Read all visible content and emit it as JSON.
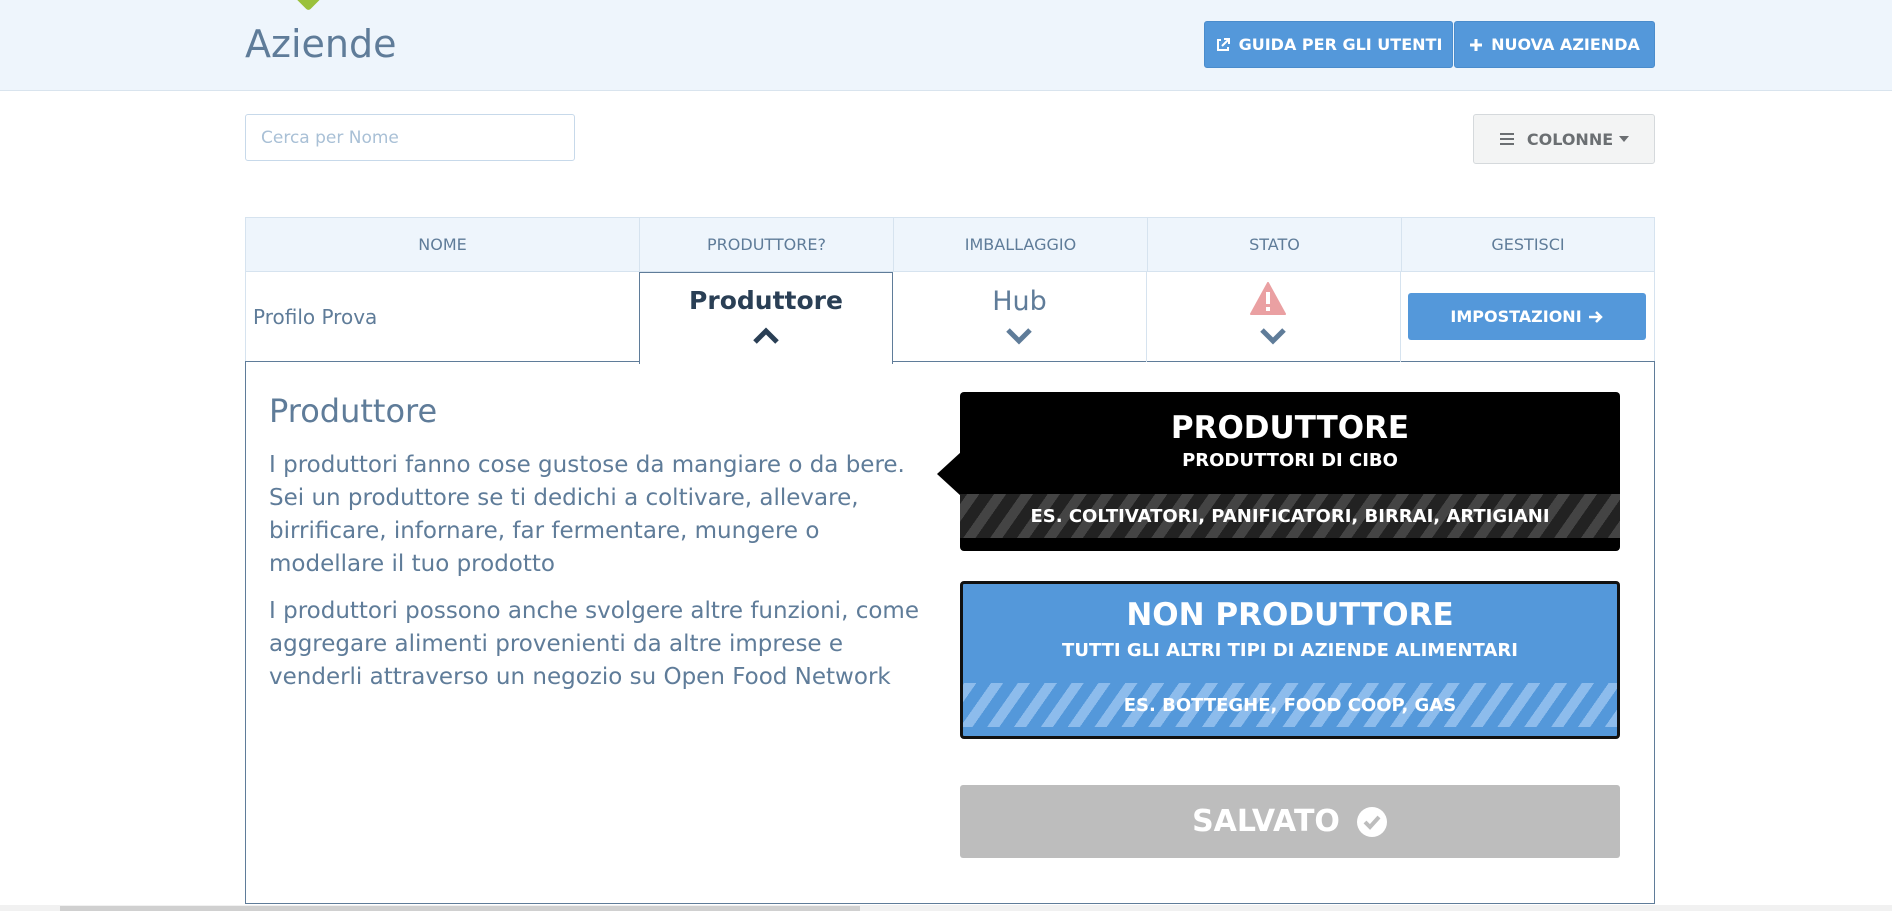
{
  "header": {
    "title": "Aziende",
    "guide_button": "GUIDA PER GLI UTENTI",
    "new_button": "NUOVA AZIENDA",
    "brand_color": "#5498da"
  },
  "toolbar": {
    "search_placeholder": "Cerca per Nome",
    "search_value": "",
    "columns_button": "COLONNE"
  },
  "table": {
    "columns": [
      "NOME",
      "PRODUTTORE?",
      "IMBALLAGGIO",
      "STATO",
      "GESTISCI"
    ],
    "rows": [
      {
        "name": "Profilo Prova",
        "producer": "Produttore",
        "packaging": "Hub",
        "status_icon": "warning-icon",
        "manage_button": "IMPOSTAZIONI"
      }
    ]
  },
  "panel": {
    "title": "Produttore",
    "paragraph1": "I produttori fanno cose gustose da mangiare o da bere. Sei un produttore se ti dedichi a coltivare, allevare, birrificare, infornare, far fermentare, mungere o modellare il tuo prodotto",
    "paragraph2": "I produttori possono anche svolgere altre funzioni, come aggregare alimenti provenienti da altre imprese e venderli attraverso un negozio su Open Food Network",
    "option_producer": {
      "title": "PRODUTTORE",
      "subtitle": "PRODUTTORI DI CIBO",
      "examples": "ES. COLTIVATORI, PANIFICATORI, BIRRAI, ARTIGIANI"
    },
    "option_non_producer": {
      "title": "NON PRODUTTORE",
      "subtitle": "TUTTI GLI ALTRI TIPI DI AZIENDE ALIMENTARI",
      "examples": "ES. BOTTEGHE, FOOD COOP, GAS"
    },
    "save_button": "SALVATO"
  }
}
